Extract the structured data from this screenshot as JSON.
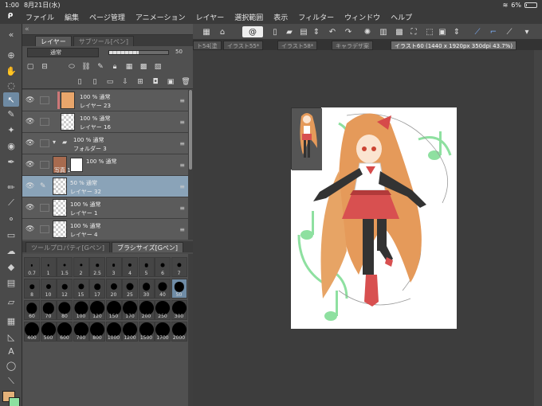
{
  "status_bar": {
    "time": "1:00",
    "date": "8月21日(水)",
    "battery_percent": "6%",
    "battery_level": 0.06
  },
  "menu": {
    "items": [
      "ファイル",
      "編集",
      "ページ管理",
      "アニメーション",
      "レイヤー",
      "選択範囲",
      "表示",
      "フィルター",
      "ウィンドウ",
      "ヘルプ"
    ]
  },
  "left_panel": {
    "tabs": [
      "レイヤー",
      "サブツール[ペン]"
    ],
    "blend_mode": "通常",
    "opacity": "50",
    "opacity_level": 0.5,
    "layers": [
      {
        "mode": "100 % 通常",
        "name": "レイヤー 23",
        "kind": "raster",
        "selected": false
      },
      {
        "mode": "100 % 通常",
        "name": "レイヤー 16",
        "kind": "raster",
        "selected": false
      },
      {
        "mode": "100 % 通常",
        "name": "フォルダー 3",
        "kind": "folder",
        "selected": false
      },
      {
        "mode": "100 % 通常",
        "name": "写真 1",
        "kind": "masked",
        "selected": false
      },
      {
        "mode": "50 % 通常",
        "name": "レイヤー 32",
        "kind": "raster",
        "selected": true
      },
      {
        "mode": "100 % 通常",
        "name": "レイヤー 1",
        "kind": "raster",
        "selected": false
      },
      {
        "mode": "100 % 通常",
        "name": "レイヤー 4",
        "kind": "raster",
        "selected": false
      }
    ],
    "brush_tabs": [
      "ツールプロパティ[Gペン]",
      "ブラシサイズ[Gペン]"
    ],
    "brush_sizes": [
      "0.7",
      "1",
      "1.5",
      "2",
      "2.5",
      "3",
      "4",
      "5",
      "6",
      "7",
      "8",
      "10",
      "12",
      "15",
      "17",
      "20",
      "25",
      "30",
      "40",
      "50",
      "60",
      "70",
      "80",
      "100",
      "120",
      "150",
      "170",
      "200",
      "250",
      "300",
      "400",
      "500",
      "600",
      "700",
      "800",
      "1000",
      "1200",
      "1500",
      "1700",
      "2000"
    ],
    "selected_brush_size": "50"
  },
  "colors": {
    "main": "#e3b179",
    "sub": "#8de0a0",
    "selection": "#8aa3b8"
  },
  "doc_tabs": [
    "ト54[塗",
    "イラスト55*",
    "イラスト58*",
    "キャラデザ案",
    "イラスト60 (1440 x 1920px 350dpi 43.7%)"
  ]
}
